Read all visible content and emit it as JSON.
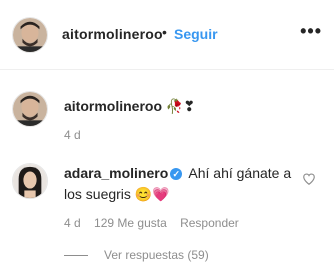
{
  "header": {
    "username": "aitormolineroo",
    "separator": "•",
    "follow_label": "Seguir",
    "more_icon": "more-horizontal-icon"
  },
  "post": {
    "username": "aitormolineroo",
    "caption": "🥀❣",
    "time": "4 d"
  },
  "comment": {
    "username": "adara_molinero",
    "verified_icon": "verified-badge-icon",
    "text": "Ahí ahí gánate a los suegris 😊💗",
    "time": "4 d",
    "likes": "129 Me gusta",
    "reply_label": "Responder",
    "like_icon": "heart-outline-icon",
    "view_replies": "Ver respuestas (59)"
  },
  "colors": {
    "accent": "#3897f0",
    "muted": "#8e8e8e",
    "text": "#262626"
  }
}
